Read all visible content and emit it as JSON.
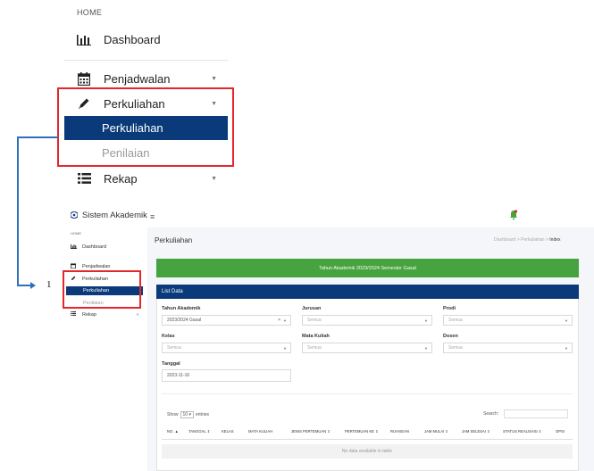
{
  "zoom_sidebar": {
    "home": "HOME",
    "dashboard": "Dashboard",
    "penjadwalan": "Penjadwalan",
    "perkuliahan": "Perkuliahan",
    "sub_perkuliahan": "Perkuliahan",
    "sub_penilaian": "Penilaian",
    "rekap": "Rekap"
  },
  "callout": {
    "number": "1"
  },
  "app": {
    "brand": "Sistem Akademik",
    "hamburger": "≡",
    "sidebar": {
      "home": "HOME",
      "dashboard": "Dashboard",
      "penjadwalan": "Penjadwalan",
      "perkuliahan": "Perkuliahan",
      "sub_perkuliahan": "Perkuliahan",
      "sub_penilaian": "Penilaian",
      "rekap": "Rekap"
    },
    "page_title": "Perkuliahan",
    "breadcrumb": [
      "Dashboard",
      "Perkuliahan",
      "Index"
    ],
    "banner": "Tahun Akademik 2023/2024 Semester Gasal",
    "card_title": "List Data",
    "filters": {
      "tahun_label": "Tahun Akademik",
      "tahun_value": "2023/2024 Gasal",
      "jurusan_label": "Jurusan",
      "jurusan_value": "Semua",
      "prodi_label": "Prodi",
      "prodi_value": "Semua",
      "kelas_label": "Kelas",
      "kelas_value": "Semua",
      "matkul_label": "Mata Kuliah",
      "matkul_value": "Semua",
      "dosen_label": "Dosen",
      "dosen_value": "Semua",
      "tanggal_label": "Tanggal",
      "tanggal_value": "2023-11-16"
    },
    "table": {
      "show_label": "Show",
      "show_value": "10",
      "entries_label": "entries",
      "search_label": "Search:",
      "columns": [
        "NO.",
        "TANGGAL",
        "KELAS",
        "MATA KULIAH",
        "JENIS PERTEMUAN",
        "PERTEMUAN KE",
        "RUANGAN",
        "JAM MULAI",
        "JAM SELESAI",
        "STATUS REALISASI",
        "OPSI"
      ],
      "empty_message": "No data available in table"
    },
    "colors": {
      "primary": "#0b3a7a",
      "success": "#46a33f",
      "highlight": "#e5262b",
      "connector": "#2f6fbb"
    }
  }
}
